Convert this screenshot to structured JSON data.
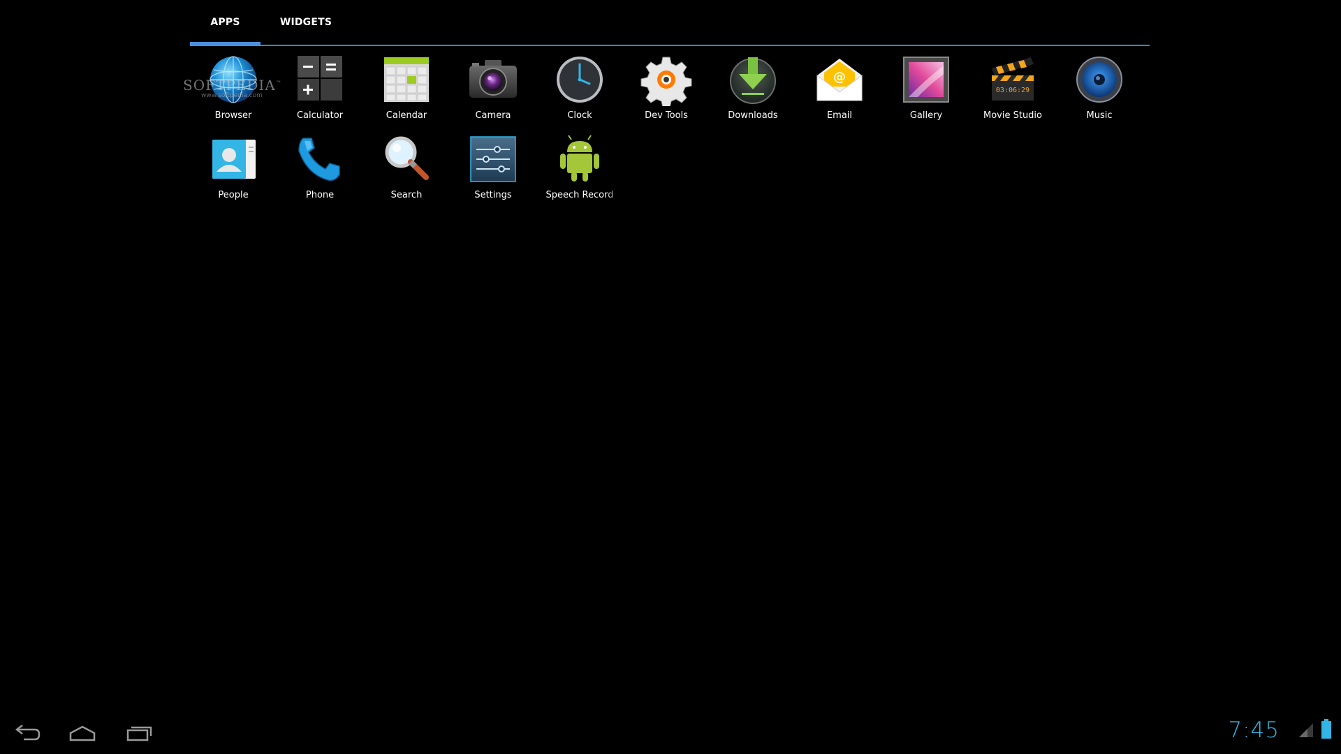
{
  "tabs": [
    {
      "label": "APPS",
      "selected": true
    },
    {
      "label": "WIDGETS",
      "selected": false
    }
  ],
  "apps": [
    {
      "label": "Browser",
      "icon": "globe-icon"
    },
    {
      "label": "Calculator",
      "icon": "calculator-icon"
    },
    {
      "label": "Calendar",
      "icon": "calendar-icon"
    },
    {
      "label": "Camera",
      "icon": "camera-icon"
    },
    {
      "label": "Clock",
      "icon": "clock-icon"
    },
    {
      "label": "Dev Tools",
      "icon": "gear-icon"
    },
    {
      "label": "Downloads",
      "icon": "download-icon"
    },
    {
      "label": "Email",
      "icon": "envelope-icon"
    },
    {
      "label": "Gallery",
      "icon": "picture-frame-icon"
    },
    {
      "label": "Movie Studio",
      "icon": "clapperboard-icon"
    },
    {
      "label": "Music",
      "icon": "speaker-icon"
    },
    {
      "label": "People",
      "icon": "contact-card-icon"
    },
    {
      "label": "Phone",
      "icon": "phone-handset-icon"
    },
    {
      "label": "Search",
      "icon": "magnifier-icon"
    },
    {
      "label": "Settings",
      "icon": "sliders-icon"
    },
    {
      "label": "Speech Record",
      "icon": "android-robot-icon"
    }
  ],
  "movie_studio_display": "03:06:29",
  "watermark": {
    "title": "SOFTPEDIA",
    "tm": "™",
    "url": "www.softpedia.com"
  },
  "status": {
    "time": "7:45",
    "accent_color": "#33b5e5"
  },
  "nav": {
    "back": "back-arrow-icon",
    "home": "home-icon",
    "recents": "recent-apps-icon"
  }
}
